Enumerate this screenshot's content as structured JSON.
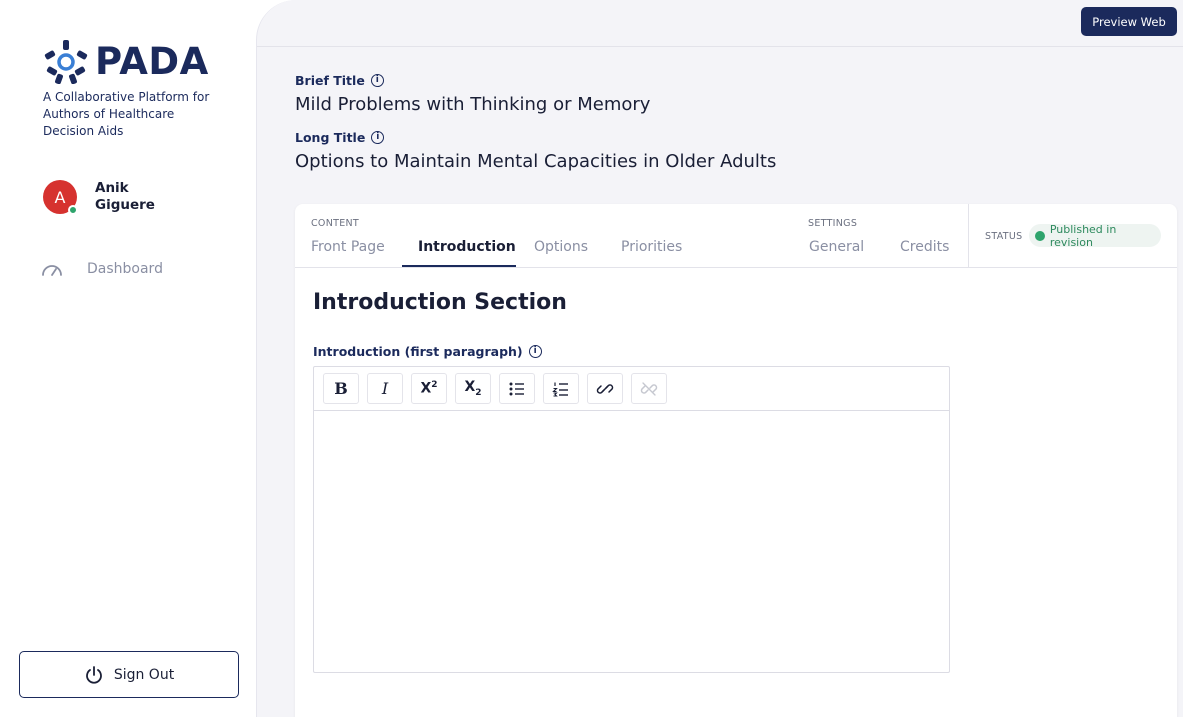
{
  "brand": {
    "name": "PADA",
    "tagline": "A Collaborative Platform for Authors of Healthcare Decision Aids",
    "color": "#1b2a5c",
    "accent": "#3a7fd5"
  },
  "user": {
    "initial": "A",
    "name": "Anik Giguere",
    "avatar_color": "#d6322f",
    "online": true
  },
  "sidebar": {
    "nav": [
      {
        "label": "Dashboard",
        "icon": "gauge-icon"
      }
    ],
    "signout_label": "Sign Out"
  },
  "header": {
    "preview_label": "Preview Web"
  },
  "fields": {
    "brief_title_label": "Brief Title",
    "brief_title_value": "Mild Problems with Thinking or Memory",
    "long_title_label": "Long Title",
    "long_title_value": "Options to Maintain Mental Capacities in Older Adults"
  },
  "tabs": {
    "content_label": "CONTENT",
    "content": [
      "Front Page",
      "Introduction",
      "Options",
      "Priorities"
    ],
    "settings_label": "SETTINGS",
    "settings": [
      "General",
      "Credits"
    ],
    "active": "Introduction"
  },
  "status": {
    "label": "STATUS",
    "value": "Published in revision",
    "color": "#2ea46c"
  },
  "section": {
    "title": "Introduction Section",
    "editor_label": "Introduction (first paragraph)",
    "toolbar": [
      "bold-icon",
      "italic-icon",
      "superscript-icon",
      "subscript-icon",
      "bullet-list-icon",
      "numbered-list-icon",
      "link-icon",
      "unlink-icon"
    ],
    "content": ""
  }
}
